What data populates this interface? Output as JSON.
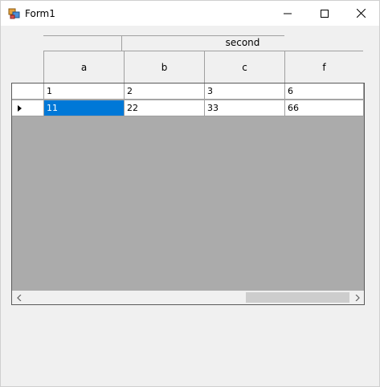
{
  "window": {
    "title": "Form1"
  },
  "header": {
    "group_label": "second",
    "columns": [
      "a",
      "b",
      "c",
      "f"
    ]
  },
  "grid": {
    "rows": [
      {
        "cells": [
          "1",
          "2",
          "3",
          "6"
        ],
        "current": false
      },
      {
        "cells": [
          "11",
          "22",
          "33",
          "66"
        ],
        "current": true
      }
    ]
  },
  "icons": {
    "app": "form-app-icon",
    "minimize": "minimize-icon",
    "maximize": "maximize-icon",
    "close": "close-icon",
    "row_indicator": "current-row-arrow-icon",
    "scroll_left": "chevron-left-icon",
    "scroll_right": "chevron-right-icon"
  },
  "colors": {
    "selection": "#0078d7",
    "grid_background": "#ababab"
  }
}
